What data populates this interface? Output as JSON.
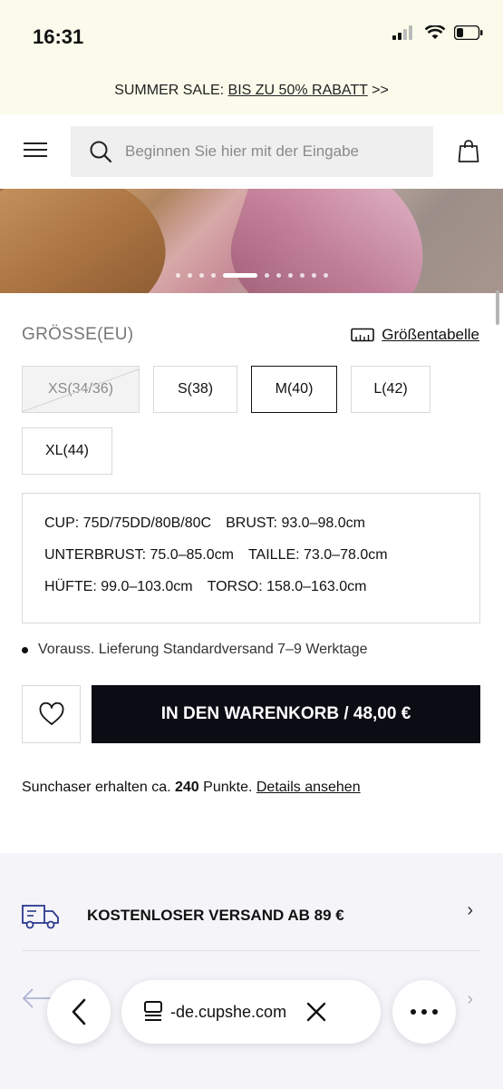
{
  "status_bar": {
    "time": "16:31"
  },
  "promo": {
    "prefix": "SUMMER SALE: ",
    "link": "BIS ZU 50% RABATT",
    "suffix": " >>"
  },
  "header": {
    "search_placeholder": "Beginnen Sie hier mit der Eingabe"
  },
  "gallery": {
    "slide_count": 11,
    "active_index": 4
  },
  "size_section": {
    "label": "GRÖSSE(EU)",
    "chart_link": "Größentabelle",
    "sizes": [
      {
        "label": "XS(34/36)",
        "state": "disabled"
      },
      {
        "label": "S(38)",
        "state": "available"
      },
      {
        "label": "M(40)",
        "state": "selected"
      },
      {
        "label": "L(42)",
        "state": "available"
      },
      {
        "label": "XL(44)",
        "state": "available"
      }
    ]
  },
  "measurements": {
    "row1": [
      "CUP: 75D/75DD/80B/80C",
      "BRUST: 93.0–98.0cm"
    ],
    "row2": [
      "UNTERBRUST: 75.0–85.0cm",
      "TAILLE: 73.0–78.0cm"
    ],
    "row3": [
      "HÜFTE: 99.0–103.0cm",
      "TORSO: 158.0–163.0cm"
    ]
  },
  "delivery": {
    "text": "Vorauss. Lieferung Standardversand 7–9 Werktage"
  },
  "cart": {
    "button_label": "IN DEN WARENKORB / 48,00 €"
  },
  "points": {
    "prefix": "Sunchaser erhalten ca. ",
    "amount": "240",
    "suffix": " Punkte. ",
    "link": "Details ansehen"
  },
  "info": {
    "shipping_label": "KOSTENLOSER VERSAND AB 89 €"
  },
  "browser": {
    "url": "-de.cupshe.com"
  },
  "colors": {
    "banner_bg": "#fbfbeb",
    "cart_button": "#0b0c14",
    "info_bg": "#f5f5f9"
  }
}
